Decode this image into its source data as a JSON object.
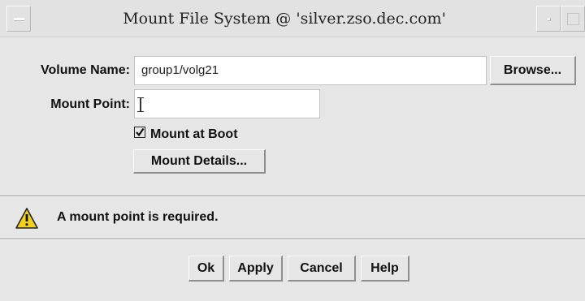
{
  "window": {
    "title": "Mount File System @ 'silver.zso.dec.com'"
  },
  "form": {
    "volume_label": "Volume Name:",
    "volume_value": "group1/volg21",
    "browse_label": "Browse...",
    "mount_point_label": "Mount Point:",
    "mount_point_value": "",
    "mount_at_boot": {
      "label": "Mount at Boot",
      "checked": true
    },
    "details_label": "Mount Details..."
  },
  "status": {
    "icon": "warning-icon",
    "message": "A mount point is required."
  },
  "buttons": {
    "ok": "Ok",
    "apply": "Apply",
    "cancel": "Cancel",
    "help": "Help"
  },
  "colors": {
    "background": "#e6e6e6",
    "warning": "#f2d21a"
  }
}
